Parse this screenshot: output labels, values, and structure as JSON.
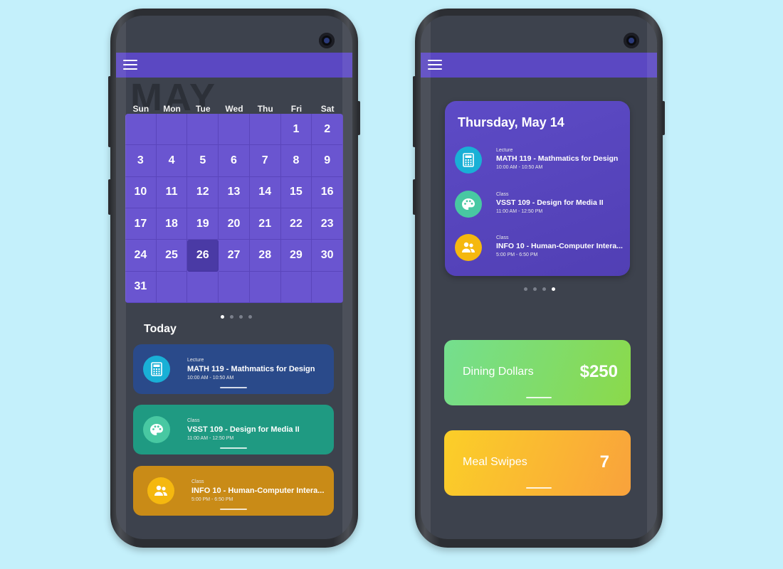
{
  "left_phone": {
    "month": "MAY",
    "weekdays": [
      "Sun",
      "Mon",
      "Tue",
      "Wed",
      "Thu",
      "Fri",
      "Sat"
    ],
    "days": [
      "",
      "",
      "",
      "",
      "",
      "1",
      "2",
      "3",
      "4",
      "5",
      "6",
      "7",
      "8",
      "9",
      "10",
      "11",
      "12",
      "13",
      "14",
      "15",
      "16",
      "17",
      "18",
      "19",
      "20",
      "21",
      "22",
      "23",
      "24",
      "25",
      "26",
      "27",
      "28",
      "29",
      "30",
      "31",
      "",
      "",
      "",
      "",
      "",
      ""
    ],
    "selected_day": "26",
    "pager": {
      "count": 4,
      "active": 0
    },
    "today_title": "Today",
    "events": [
      {
        "type": "Lecture",
        "name": "MATH 119 - Mathmatics for Design",
        "time": "10:00 AM - 10:50 AM",
        "icon": "calculator-icon",
        "card_color": "#2a4a8a",
        "icon_color": "#19b0d6"
      },
      {
        "type": "Class",
        "name": "VSST 109 - Design for Media II",
        "time": "11:00 AM - 12:50 PM",
        "icon": "palette-icon",
        "card_color": "#1f9a82",
        "icon_color": "#48c8a2"
      },
      {
        "type": "Class",
        "name": "INFO 10 - Human-Computer Intera...",
        "time": "5:00 PM - 6:50 PM",
        "icon": "people-icon",
        "card_color": "#c98b17",
        "icon_color": "#f5b80f"
      }
    ]
  },
  "right_phone": {
    "day_card": {
      "title": "Thursday, May 14",
      "items": [
        {
          "type": "Lecture",
          "name": "MATH 119 - Mathmatics for Design",
          "time": "10:00 AM - 10:50 AM",
          "icon": "calculator-icon",
          "icon_color": "#19b0d6"
        },
        {
          "type": "Class",
          "name": "VSST 109 - Design for Media II",
          "time": "11:00 AM - 12:50 PM",
          "icon": "palette-icon",
          "icon_color": "#48c8a2"
        },
        {
          "type": "Class",
          "name": "INFO 10 - Human-Computer Intera...",
          "time": "5:00 PM - 6:50 PM",
          "icon": "people-icon",
          "icon_color": "#f5b80f"
        }
      ]
    },
    "pager": {
      "count": 4,
      "active": 3
    },
    "balances": [
      {
        "label": "Dining Dollars",
        "value": "$250",
        "gradient": [
          "#74df8f",
          "#8bd94a"
        ]
      },
      {
        "label": "Meal Swipes",
        "value": "7",
        "gradient": [
          "#fbcf28",
          "#f9a23c"
        ]
      }
    ]
  },
  "colors": {
    "background": "#c4f0fb",
    "screen": "#3d424d",
    "accent": "#5b48c2",
    "calendar": "#6a55d0"
  }
}
